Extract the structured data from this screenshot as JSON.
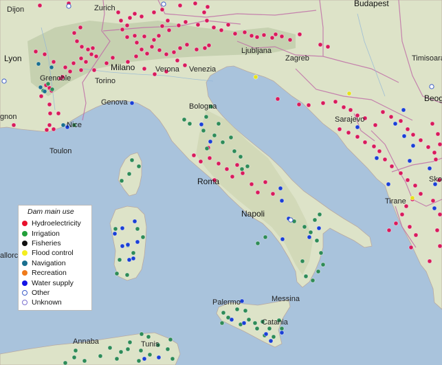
{
  "map": {
    "cities": [
      {
        "key": "dijon",
        "name": "Dijon"
      },
      {
        "key": "zurich",
        "name": "Zurich"
      },
      {
        "key": "budapest",
        "name": "Budapest"
      },
      {
        "key": "lyon",
        "name": "Lyon"
      },
      {
        "key": "ljubljana",
        "name": "Ljubljana"
      },
      {
        "key": "zagreb",
        "name": "Zagreb"
      },
      {
        "key": "timisoara",
        "name": "Timisoara"
      },
      {
        "key": "grenoble",
        "name": "Grenoble"
      },
      {
        "key": "milano",
        "name": "Milano"
      },
      {
        "key": "verona",
        "name": "Verona"
      },
      {
        "key": "venezia",
        "name": "Venezia"
      },
      {
        "key": "torino",
        "name": "Torino"
      },
      {
        "key": "genova",
        "name": "Genova"
      },
      {
        "key": "bologna",
        "name": "Bologna"
      },
      {
        "key": "beograd",
        "name": "Beog"
      },
      {
        "key": "avignon",
        "name": "gnon"
      },
      {
        "key": "nice",
        "name": "Nice"
      },
      {
        "key": "sarajevo",
        "name": "Sarajevo"
      },
      {
        "key": "toulon",
        "name": "Toulon"
      },
      {
        "key": "roma",
        "name": "Roma"
      },
      {
        "key": "skopje",
        "name": "Skop"
      },
      {
        "key": "tirane",
        "name": "Tirane"
      },
      {
        "key": "napoli",
        "name": "Napoli"
      },
      {
        "key": "mallorca",
        "name": "allorca"
      },
      {
        "key": "palermo",
        "name": "Palermo"
      },
      {
        "key": "messina",
        "name": "Messina"
      },
      {
        "key": "catania",
        "name": "Catania"
      },
      {
        "key": "annaba",
        "name": "Annaba"
      },
      {
        "key": "tunis",
        "name": "Tunis"
      }
    ]
  },
  "legend": {
    "title": "Dam main use",
    "items": [
      {
        "label": "Hydroelectricity",
        "color": "#e8112d",
        "hollow": false
      },
      {
        "label": "Irrigation",
        "color": "#22a03a",
        "hollow": false
      },
      {
        "label": "Fisheries",
        "color": "#111111",
        "hollow": false
      },
      {
        "label": "Flood control",
        "color": "#f4ee1e",
        "hollow": false
      },
      {
        "label": "Navigation",
        "color": "#1a6f8f",
        "hollow": false
      },
      {
        "label": "Recreation",
        "color": "#ef7a1a",
        "hollow": false
      },
      {
        "label": "Water supply",
        "color": "#1414e6",
        "hollow": false
      },
      {
        "label": "Other",
        "color": "#3a5bc7",
        "hollow": true
      },
      {
        "label": "Unknown",
        "color": "#7a6fcf",
        "hollow": true
      }
    ]
  },
  "dam_colors": {
    "hydro": "#d81b5c",
    "irrigation": "#2e8b57",
    "water": "#1a3fd6",
    "navigation": "#1a6f8f",
    "flood": "#e6e21a",
    "other": "#ffffff"
  }
}
